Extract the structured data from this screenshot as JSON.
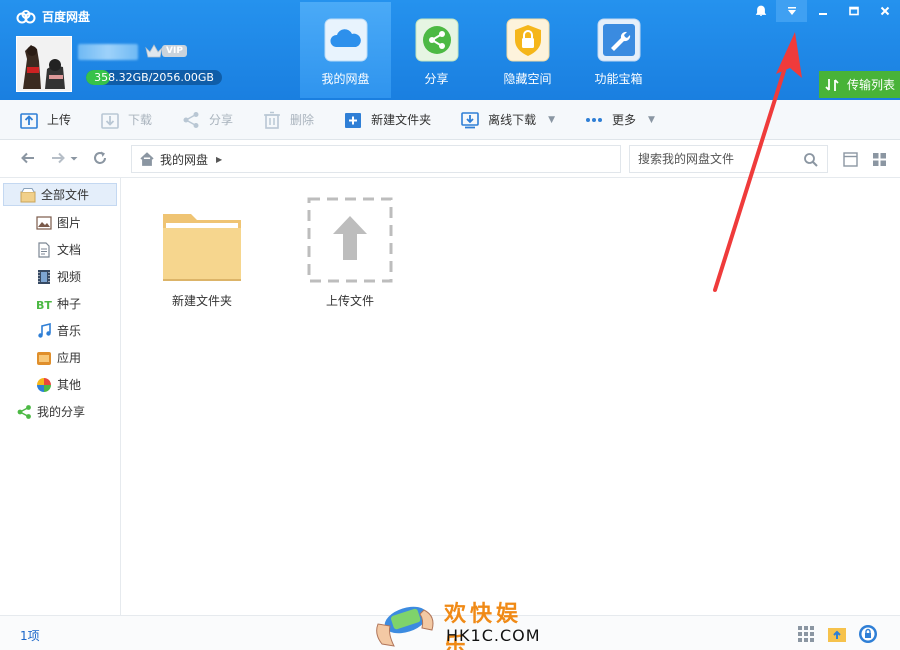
{
  "app": {
    "title": "百度网盘",
    "quota_text": "358.32GB/2056.00GB",
    "quota_used_fraction": 0.174,
    "vip_label": "VIP"
  },
  "nav_tabs": [
    {
      "label": "我的网盘",
      "icon": "cloud-icon",
      "active": true
    },
    {
      "label": "分享",
      "icon": "share-icon",
      "active": false
    },
    {
      "label": "隐藏空间",
      "icon": "lock-icon",
      "active": false
    },
    {
      "label": "功能宝箱",
      "icon": "wrench-icon",
      "active": false
    }
  ],
  "window_controls": [
    "bell-icon",
    "dropdown-icon",
    "minimize-icon",
    "maximize-icon",
    "close-icon"
  ],
  "transfer_list_label": "传输列表",
  "toolbar": {
    "upload": "上传",
    "download": "下载",
    "share": "分享",
    "delete": "删除",
    "new_folder": "新建文件夹",
    "offline_download": "离线下载",
    "more": "更多"
  },
  "address": {
    "breadcrumb": "我的网盘",
    "search_placeholder": "搜索我的网盘文件"
  },
  "sidebar": {
    "root": "全部文件",
    "items": [
      {
        "label": "图片",
        "icon": "image-icon"
      },
      {
        "label": "文档",
        "icon": "document-icon"
      },
      {
        "label": "视频",
        "icon": "video-icon"
      },
      {
        "label": "种子",
        "icon": "bt-icon"
      },
      {
        "label": "音乐",
        "icon": "music-icon"
      },
      {
        "label": "应用",
        "icon": "app-icon"
      },
      {
        "label": "其他",
        "icon": "other-icon"
      }
    ],
    "my_share": "我的分享"
  },
  "files": [
    {
      "name": "新建文件夹",
      "type": "folder"
    },
    {
      "name": "上传文件",
      "type": "upload-placeholder"
    }
  ],
  "status": {
    "count": "1项"
  },
  "watermark": {
    "cn": "欢快娱乐",
    "en": "HK1C.COM"
  },
  "colors": {
    "header_blue": "#1e88e5",
    "active_tab": "#3fa3f5",
    "transfer_green": "#48b338",
    "quota_green": "#37c24a",
    "annotation_red": "#ef3b3b",
    "folder_yellow": "#f6d68e"
  }
}
